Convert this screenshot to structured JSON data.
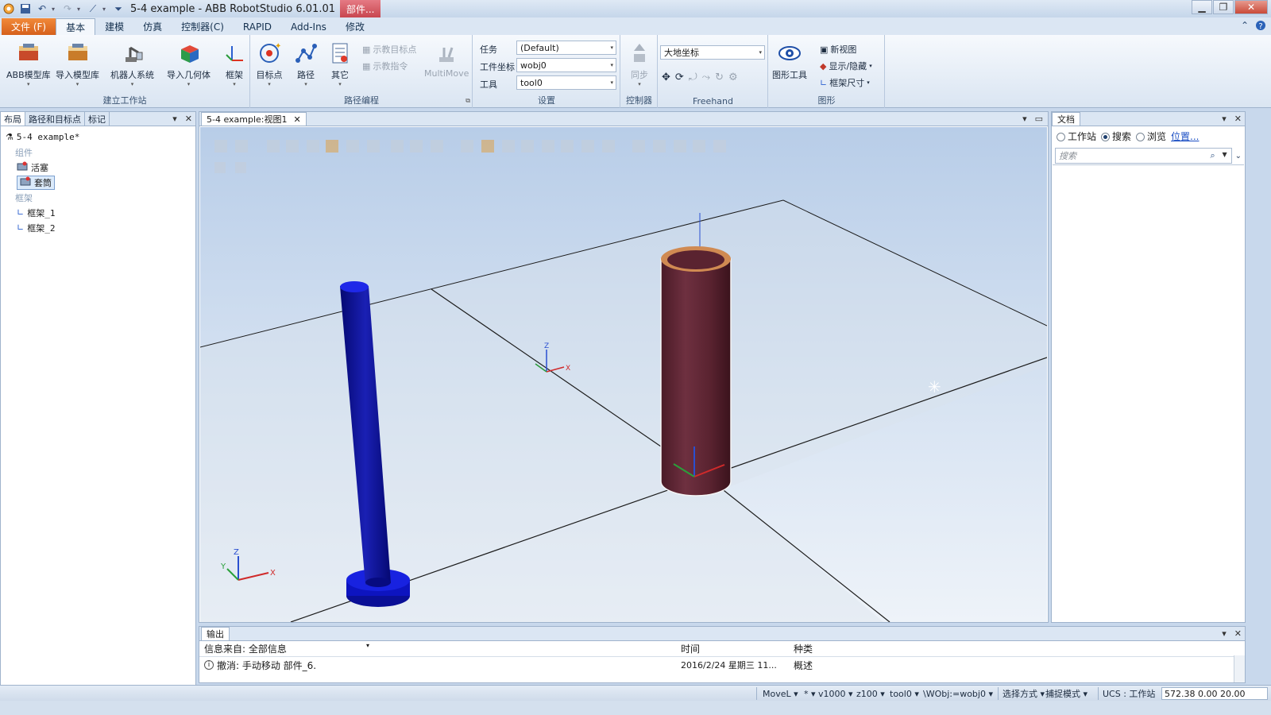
{
  "titlebar": {
    "app_title": "5-4 example - ABB RobotStudio 6.01.01",
    "context_tab": "部件..."
  },
  "ribbon_tabs": {
    "file": "文件 (F)",
    "tabs": [
      "基本",
      "建模",
      "仿真",
      "控制器(C)",
      "RAPID",
      "Add-Ins",
      "修改"
    ]
  },
  "ribbon": {
    "group_build_station": {
      "label": "建立工作站",
      "abb_library": "ABB模型库",
      "import_library": "导入模型库",
      "robot_system": "机器人系统",
      "import_geometry": "导入几何体",
      "frame": "框架"
    },
    "group_path_programming": {
      "label": "路径编程",
      "target": "目标点",
      "path": "路径",
      "other": "其它",
      "teach_target": "示教目标点",
      "teach_instruction": "示教指令",
      "multimove": "MultiMove"
    },
    "group_settings": {
      "label": "设置",
      "task_label": "任务",
      "task_value": "(Default)",
      "wobj_label": "工件坐标",
      "wobj_value": "wobj0",
      "tool_label": "工具",
      "tool_value": "tool0"
    },
    "group_controller": {
      "label": "控制器",
      "sync": "同步"
    },
    "group_freehand": {
      "label": "Freehand",
      "coord_value": "大地坐标"
    },
    "group_graphics": {
      "label": "图形",
      "graphics_tools": "图形工具",
      "new_view": "新视图",
      "show_hide": "显示/隐藏",
      "frame_size": "框架尺寸"
    }
  },
  "left_panel": {
    "tabs": [
      "布局",
      "路径和目标点",
      "标记"
    ],
    "station": "5-4 example*",
    "components_header": "组件",
    "components": [
      "活塞",
      "套筒"
    ],
    "frames_header": "框架",
    "frames": [
      "框架_1",
      "框架_2"
    ]
  },
  "view": {
    "tab_title": "5-4 example:视图1"
  },
  "right_panel": {
    "title": "文档",
    "radio_station": "工作站",
    "radio_search": "搜索",
    "radio_browse": "浏览",
    "location_link": "位置...",
    "search_placeholder": "搜索"
  },
  "output": {
    "title": "输出",
    "source_label": "信息来自: 全部信息",
    "col_time": "时间",
    "col_category": "种类",
    "row_message": "撤消: 手动移动 部件_6.",
    "row_time": "2016/2/24 星期三 11...",
    "row_category": "概述"
  },
  "statusbar": {
    "instruction": "MoveL",
    "star": "*",
    "speed": "v1000",
    "zone": "z100",
    "tool": "tool0",
    "wobj": "\\WObj:=wobj0",
    "selection_mode": "选择方式",
    "snap_mode": "捕捉模式",
    "ucs": "UCS : 工作站",
    "coords": "572.38   0.00   20.00"
  },
  "colors": {
    "piston": "#0b0f96",
    "sleeve": "#5a2330",
    "sleeve_rim": "#d08a52",
    "file_tab": "#e2702a"
  }
}
